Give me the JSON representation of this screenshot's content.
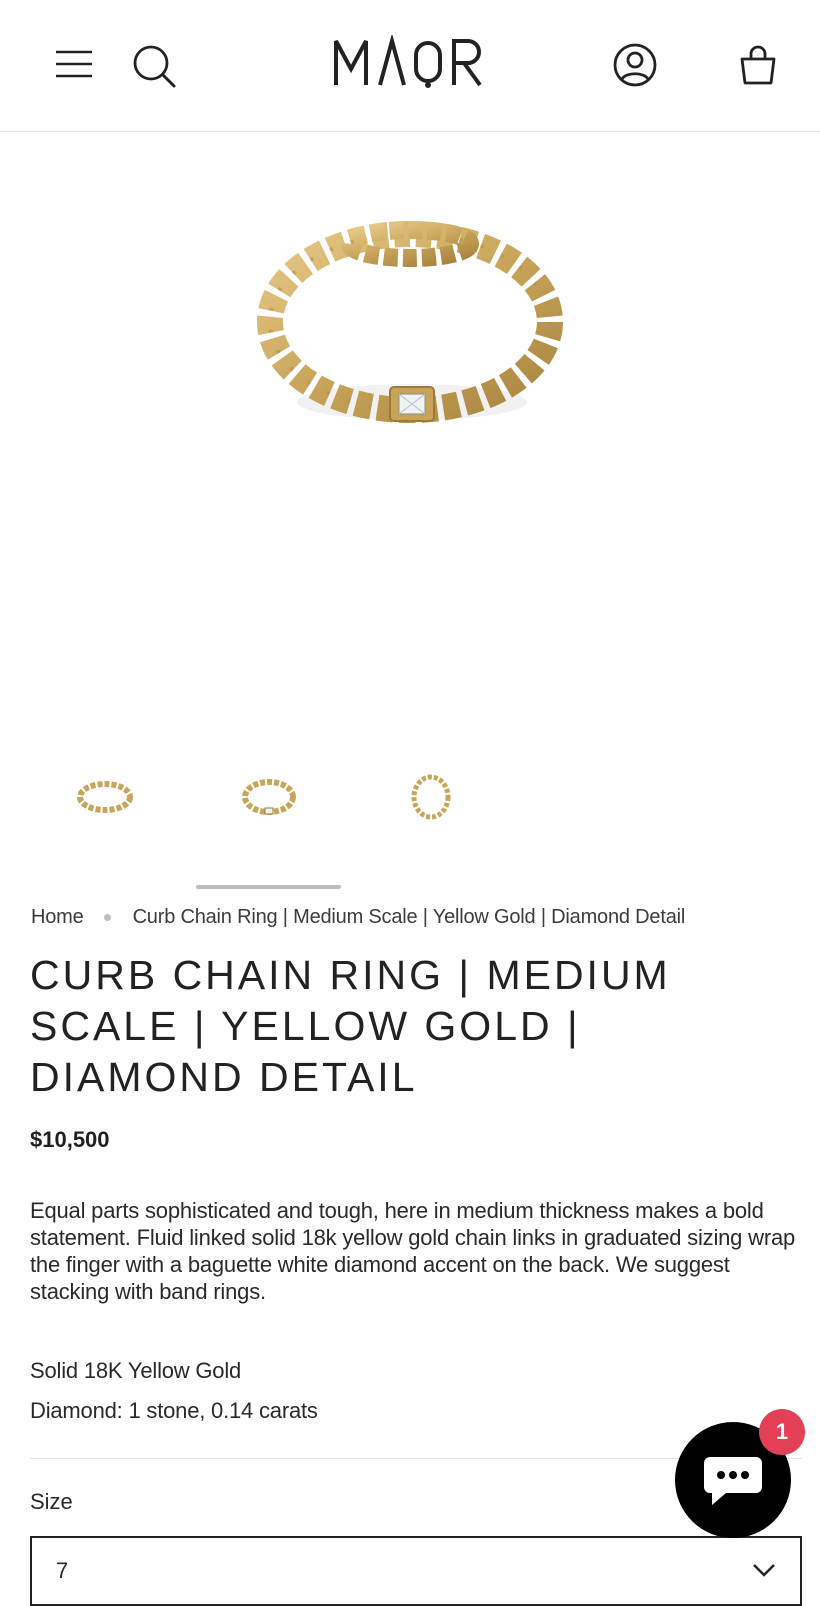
{
  "header": {
    "logo_text": "MAOR",
    "icons": [
      "menu-icon",
      "search-icon",
      "account-icon",
      "cart-icon"
    ]
  },
  "gallery": {
    "thumbnails": [
      "ring-thumbnail-1",
      "ring-thumbnail-2",
      "ring-thumbnail-3"
    ],
    "accent_color": "#c9a55b"
  },
  "breadcrumb": {
    "home": "Home",
    "current": "Curb Chain Ring | Medium Scale | Yellow Gold | Diamond Detail"
  },
  "product": {
    "title": "CURB CHAIN RING | MEDIUM SCALE | YELLOW GOLD | DIAMOND DETAIL",
    "price": "$10,500",
    "description": "Equal parts sophisticated and tough, here in medium thickness makes a bold statement. Fluid linked solid 18k yellow gold chain links in graduated sizing wrap the finger with a baguette white diamond accent on the back. We suggest stacking with band rings.",
    "material": "Solid 18K Yellow Gold",
    "stones": "Diamond: 1 stone, 0.14 carats",
    "size_label": "Size",
    "size_value": "7"
  },
  "chat": {
    "badge_count": "1",
    "badge_color": "#e34057"
  }
}
